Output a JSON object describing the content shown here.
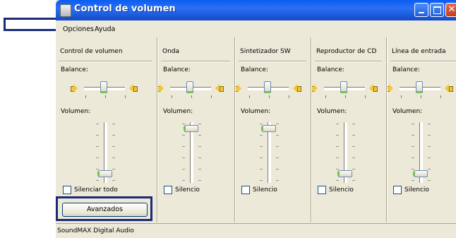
{
  "window": {
    "title": "Control de volumen",
    "close_glyph": "✕"
  },
  "menu": [
    "Opciones",
    "Ayuda"
  ],
  "labels": {
    "balance": "Balance:",
    "volume": "Volumen:"
  },
  "columns": [
    {
      "name": "Control de volumen",
      "mute_label": "Silenciar todo",
      "balance": 0.5,
      "volume": 0.15
    },
    {
      "name": "Onda",
      "mute_label": "Silencio",
      "balance": 0.5,
      "volume": 0.9
    },
    {
      "name": "Sintetizador SW",
      "mute_label": "Silencio",
      "balance": 0.5,
      "volume": 0.9
    },
    {
      "name": "Reproductor de CD",
      "mute_label": "Silencio",
      "balance": 0.5,
      "volume": 0.15
    },
    {
      "name": "Línea de entrada",
      "mute_label": "Silencio",
      "balance": 0.5,
      "volume": 0.15
    }
  ],
  "advanced_button": "Avanzados",
  "status": "SoundMAX Digital Audio",
  "colors": {
    "titlebar": "#0a5ef2",
    "face": "#ece9d8",
    "highlight": "#1c2a78"
  }
}
